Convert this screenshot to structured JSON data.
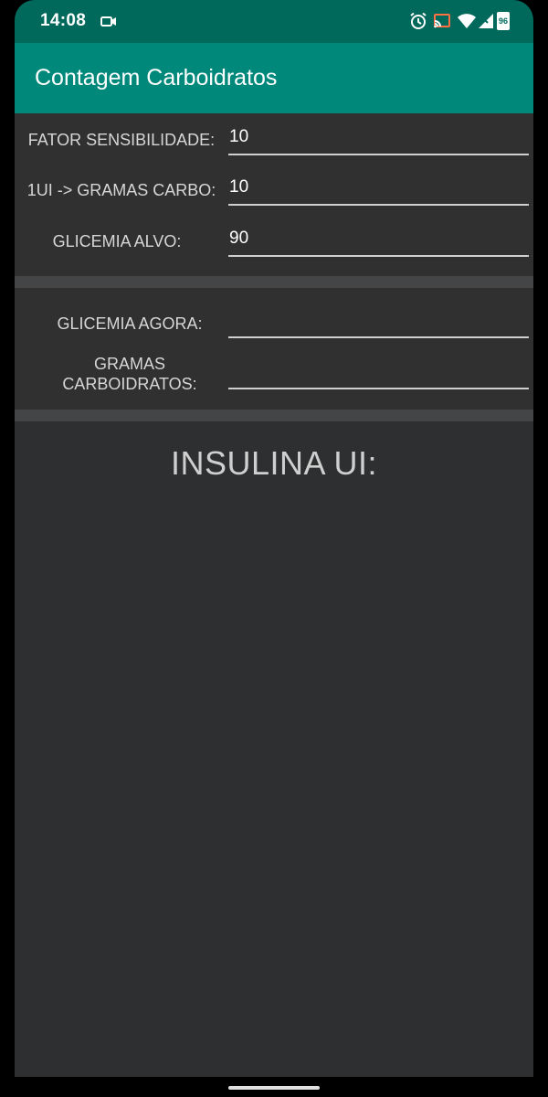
{
  "status_bar": {
    "time": "14:08",
    "battery_level": "96",
    "icons": [
      "video-camera-icon",
      "alarm-icon",
      "cast-icon",
      "wifi-icon",
      "cellular-signal-icon",
      "battery-icon"
    ]
  },
  "app_bar": {
    "title": "Contagem Carboidratos"
  },
  "settings": {
    "sensitivity_label": "FATOR SENSIBILIDADE:",
    "sensitivity_value": "10",
    "ratio_label": "1UI -> GRAMAS CARBO:",
    "ratio_value": "10",
    "target_label": "GLICEMIA ALVO:",
    "target_value": "90"
  },
  "inputs": {
    "glucose_now_label": "GLICEMIA AGORA:",
    "glucose_now_value": "",
    "carbs_label_line1": "GRAMAS",
    "carbs_label_line2": "CARBOIDRATOS:",
    "carbs_value": ""
  },
  "result": {
    "label": "INSULINA UI:"
  },
  "colors": {
    "status_bar": "#00695c",
    "app_bar": "#00897b",
    "background": "#303030",
    "separator": "#444546"
  }
}
